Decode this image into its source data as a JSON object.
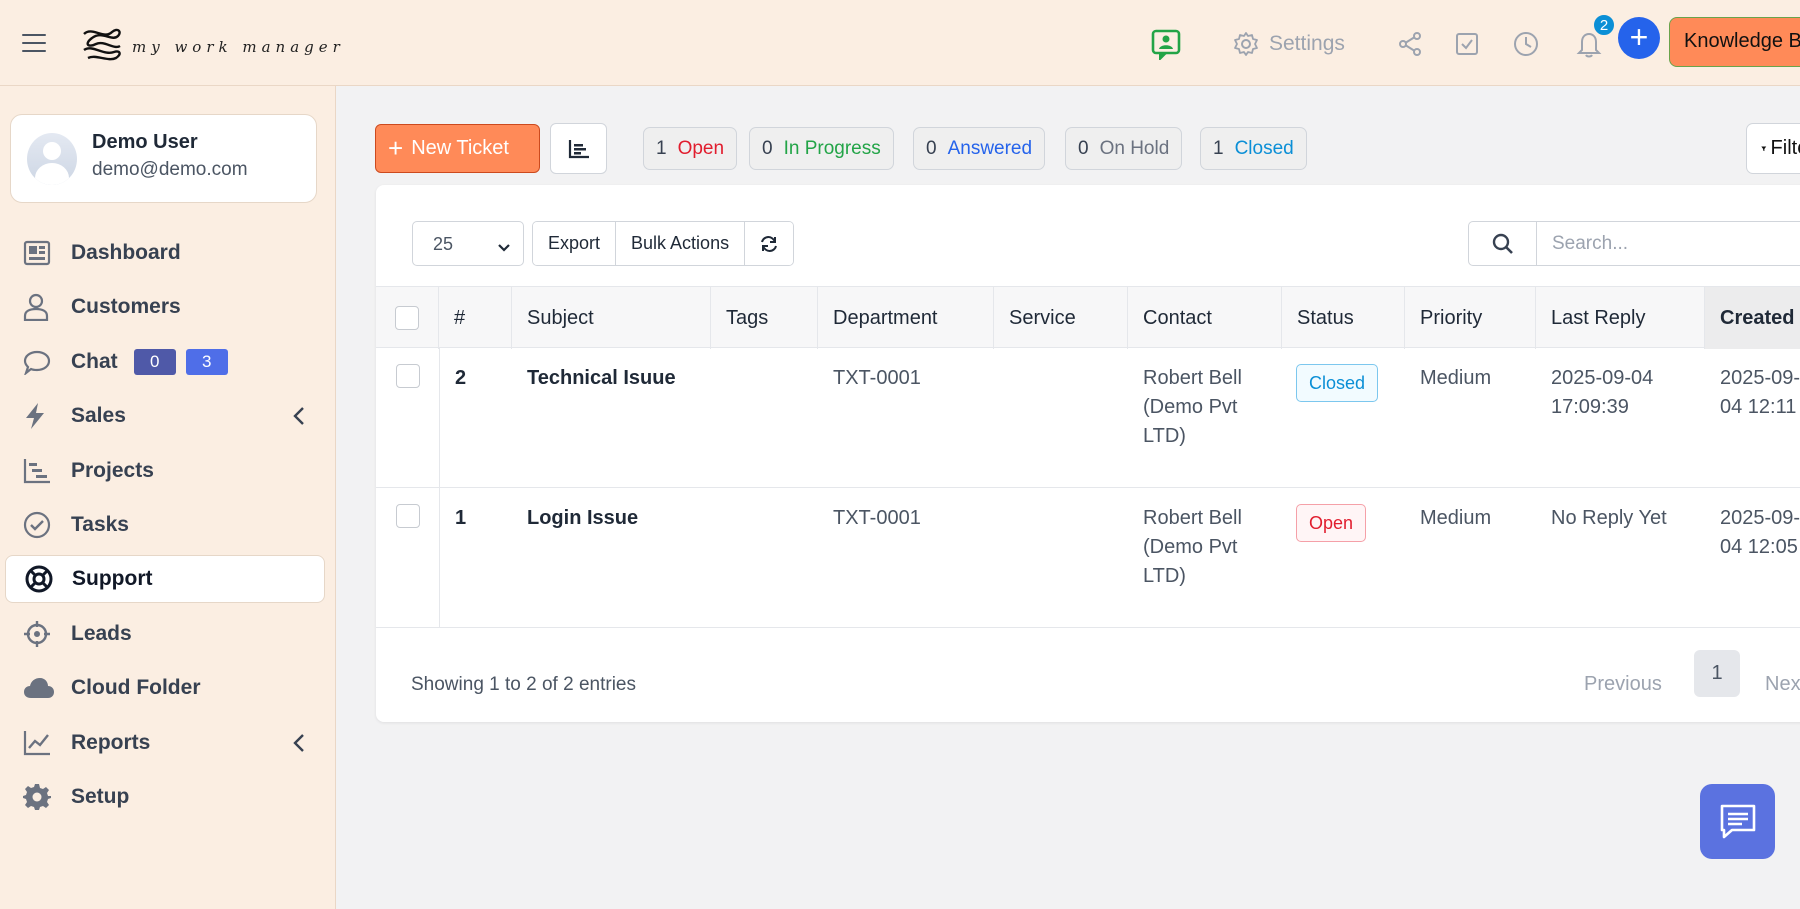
{
  "app": {
    "logo_text": "my work manager"
  },
  "header": {
    "settings_label": "Settings",
    "notification_count": "2",
    "add_label": "+",
    "knowledge_base_label": "Knowledge Base",
    "icons": [
      "message-person-icon",
      "gear-icon",
      "share-icon",
      "checkbox-icon",
      "clock-icon",
      "bell-icon"
    ]
  },
  "user": {
    "name": "Demo User",
    "email": "demo@demo.com"
  },
  "sidebar": {
    "items": [
      {
        "label": "Dashboard",
        "icon": "dashboard-icon"
      },
      {
        "label": "Customers",
        "icon": "user-icon"
      },
      {
        "label": "Chat",
        "icon": "chat-bubble-icon",
        "badges": [
          "0",
          "3"
        ]
      },
      {
        "label": "Sales",
        "icon": "bolt-icon",
        "expandable": true
      },
      {
        "label": "Projects",
        "icon": "gantt-icon"
      },
      {
        "label": "Tasks",
        "icon": "check-circle-icon"
      },
      {
        "label": "Support",
        "icon": "lifebuoy-icon",
        "active": true
      },
      {
        "label": "Leads",
        "icon": "crosshair-icon"
      },
      {
        "label": "Cloud Folder",
        "icon": "cloud-icon"
      },
      {
        "label": "Reports",
        "icon": "line-chart-icon",
        "expandable": true
      },
      {
        "label": "Setup",
        "icon": "cog-icon"
      }
    ]
  },
  "toolbar": {
    "new_ticket_label": "New Ticket",
    "filter_label": "Filters"
  },
  "status_summary": [
    {
      "count": "1",
      "label": "Open",
      "color": "#e11d2e"
    },
    {
      "count": "0",
      "label": "In Progress",
      "color": "#22a447"
    },
    {
      "count": "0",
      "label": "Answered",
      "color": "#2563eb"
    },
    {
      "count": "0",
      "label": "On Hold",
      "color": "#6b7280"
    },
    {
      "count": "1",
      "label": "Closed",
      "color": "#0b8fd6"
    }
  ],
  "table_controls": {
    "per_page": "25",
    "export_label": "Export",
    "bulk_actions_label": "Bulk Actions",
    "search_placeholder": "Search..."
  },
  "table": {
    "columns": [
      "#",
      "Subject",
      "Tags",
      "Department",
      "Service",
      "Contact",
      "Status",
      "Priority",
      "Last Reply",
      "Created"
    ],
    "rows": [
      {
        "id": "2",
        "subject": "Technical Isuue",
        "tags": "",
        "department": "TXT-0001",
        "service": "",
        "contact_line1": "Robert Bell",
        "contact_line2": "(Demo Pvt",
        "contact_line3": "LTD)",
        "status": "Closed",
        "priority": "Medium",
        "last_reply_line1": "2025-09-04",
        "last_reply_line2": "17:09:39",
        "created_line1": "2025-09-",
        "created_line2": "04 12:11"
      },
      {
        "id": "1",
        "subject": "Login Issue",
        "tags": "",
        "department": "TXT-0001",
        "service": "",
        "contact_line1": "Robert Bell",
        "contact_line2": "(Demo Pvt",
        "contact_line3": "LTD)",
        "status": "Open",
        "priority": "Medium",
        "last_reply_line1": "No Reply Yet",
        "last_reply_line2": "",
        "created_line1": "2025-09-",
        "created_line2": "04 12:05"
      }
    ]
  },
  "pagination": {
    "showing_text": "Showing 1 to 2 of 2 entries",
    "previous_label": "Previous",
    "current_page": "1",
    "next_label": "Next"
  }
}
